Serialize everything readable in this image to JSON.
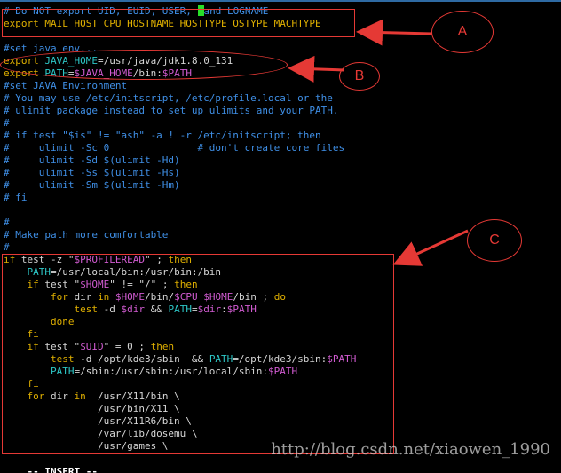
{
  "editor": {
    "lines": [
      {
        "kind": "comment",
        "text": "# Do NOT export UID, EUID, USER, ",
        "cursor": true,
        "text2": "and LOGNAME"
      },
      {
        "kind": "export",
        "text": "export MAIL HOST CPU HOSTNAME HOSTTYPE OSTYPE MACHTYPE"
      },
      {
        "kind": "blank",
        "text": ""
      },
      {
        "kind": "comment",
        "text": "#set java env..."
      },
      {
        "kind": "export-java",
        "text": "export JAVA_HOME=/usr/java/jdk1.8.0_131"
      },
      {
        "kind": "export-path",
        "text": "export PATH=$JAVA_HOME/bin:$PATH"
      },
      {
        "kind": "comment",
        "text": "#set JAVA Environment"
      },
      {
        "kind": "comment",
        "text": "# You may use /etc/initscript, /etc/profile.local or the"
      },
      {
        "kind": "comment",
        "text": "# ulimit package instead to set up ulimits and your PATH."
      },
      {
        "kind": "comment",
        "text": "#"
      },
      {
        "kind": "comment",
        "text": "# if test \"$is\" != \"ash\" -a ! -r /etc/initscript; then"
      },
      {
        "kind": "comment",
        "text": "#     ulimit -Sc 0               # don't create core files"
      },
      {
        "kind": "comment",
        "text": "#     ulimit -Sd $(ulimit -Hd)"
      },
      {
        "kind": "comment",
        "text": "#     ulimit -Ss $(ulimit -Hs)"
      },
      {
        "kind": "comment",
        "text": "#     ulimit -Sm $(ulimit -Hm)"
      },
      {
        "kind": "comment",
        "text": "# fi"
      },
      {
        "kind": "blank",
        "text": ""
      },
      {
        "kind": "comment",
        "text": "#"
      },
      {
        "kind": "comment",
        "text": "# Make path more comfortable"
      },
      {
        "kind": "comment",
        "text": "#"
      },
      {
        "kind": "code",
        "text": "if test -z \"$PROFILEREAD\" ; then"
      },
      {
        "kind": "code",
        "text": "    PATH=/usr/local/bin:/usr/bin:/bin"
      },
      {
        "kind": "code",
        "text": "    if test \"$HOME\" != \"/\" ; then"
      },
      {
        "kind": "code",
        "text": "        for dir in $HOME/bin/$CPU $HOME/bin ; do"
      },
      {
        "kind": "code",
        "text": "            test -d $dir && PATH=$dir:$PATH"
      },
      {
        "kind": "code",
        "text": "        done"
      },
      {
        "kind": "code",
        "text": "    fi"
      },
      {
        "kind": "code",
        "text": "    if test \"$UID\" = 0 ; then"
      },
      {
        "kind": "code",
        "text": "        test -d /opt/kde3/sbin  && PATH=/opt/kde3/sbin:$PATH"
      },
      {
        "kind": "code",
        "text": "        PATH=/sbin:/usr/sbin:/usr/local/sbin:$PATH"
      },
      {
        "kind": "code",
        "text": "    fi"
      },
      {
        "kind": "code",
        "text": "    for dir in  /usr/X11/bin \\"
      },
      {
        "kind": "code",
        "text": "                /usr/bin/X11 \\"
      },
      {
        "kind": "code",
        "text": "                /usr/X11R6/bin \\"
      },
      {
        "kind": "code",
        "text": "                /var/lib/dosemu \\"
      },
      {
        "kind": "code",
        "text": "                /usr/games \\"
      }
    ]
  },
  "annotations": {
    "A": "A",
    "B": "B",
    "C": "C"
  },
  "status": {
    "mode": "-- INSERT --"
  },
  "watermark": "http://blog.csdn.net/xiaowen_1990",
  "colors": {
    "comment": "#3f8fe6",
    "keyword": "#e0b000",
    "identifier": "#2dc6c6",
    "variable": "#d15bd1",
    "annotation": "#e53935",
    "cursor": "#28e028",
    "background": "#000000"
  }
}
